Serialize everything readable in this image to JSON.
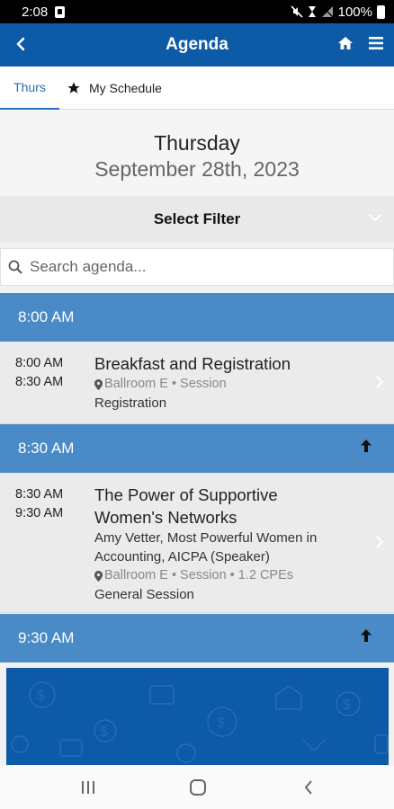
{
  "status_bar": {
    "time": "2:08",
    "battery": "100%"
  },
  "header": {
    "title": "Agenda"
  },
  "tabs": {
    "day": "Thurs",
    "my_schedule": "My Schedule"
  },
  "date": {
    "day": "Thursday",
    "full": "September 28th, 2023"
  },
  "filter": {
    "label": "Select Filter"
  },
  "search": {
    "placeholder": "Search agenda..."
  },
  "agenda": [
    {
      "time": "8:00 AM",
      "sessions": [
        {
          "start": "8:00 AM",
          "end": "8:30 AM",
          "title": "Breakfast and Registration",
          "location": "Ballroom E • Session",
          "category": "Registration"
        }
      ]
    },
    {
      "time": "8:30 AM",
      "sessions": [
        {
          "start": "8:30 AM",
          "end": "9:30 AM",
          "title_line1": "The Power of Supportive",
          "title_line2": "Women's Networks",
          "speaker_line1": "Amy Vetter, Most Powerful Women in",
          "speaker_line2": "Accounting, AICPA (Speaker)",
          "location": "Ballroom E • Session • 1.2 CPEs",
          "category": "General Session"
        }
      ]
    },
    {
      "time": "9:30 AM",
      "sessions": []
    }
  ],
  "colors": {
    "app_bar": "#0d5aa7",
    "time_header": "#4a8ac6",
    "tab_active": "#2a6db8",
    "banner": "#0c5aa8"
  },
  "icons": [
    "back-arrow-icon",
    "home-icon",
    "hamburger-menu-icon",
    "star-icon",
    "chevron-down-icon",
    "search-icon",
    "arrow-up-icon",
    "map-pin-icon",
    "chevron-right-icon",
    "recents-icon",
    "home-circle-icon",
    "back-icon"
  ]
}
